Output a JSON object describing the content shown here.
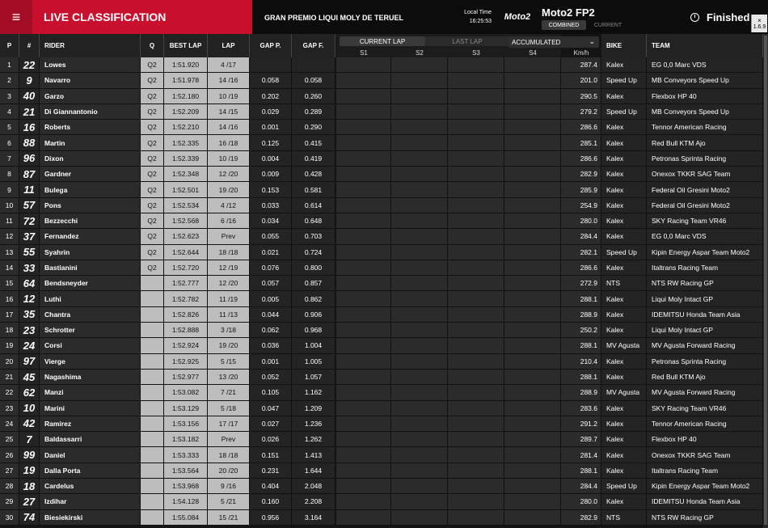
{
  "header": {
    "menu_icon": "menu-icon",
    "title": "LIVE CLASSIFICATION",
    "event": "GRAN PREMIO LIQUI MOLY DE TERUEL",
    "local_time_label": "Local Time",
    "local_time_value": "16:25:53",
    "logo_text": "Moto2",
    "session": "Moto2 FP2",
    "tab_combined": "COMBINED",
    "tab_current": "CURRENT",
    "status": "Finished",
    "version_close": "×",
    "version": "1.6.9",
    "accent_color": "#c8102e"
  },
  "columns": {
    "pos": "P",
    "num": "#",
    "rider": "RIDER",
    "q": "Q",
    "best_lap": "BEST LAP",
    "lap": "LAP",
    "gap_p": "GAP P.",
    "gap_f": "GAP F.",
    "bike": "BIKE",
    "team": "TEAM",
    "kmh": "Km/h",
    "s1": "S1",
    "s2": "S2",
    "s3": "S3",
    "s4": "S4"
  },
  "lap_mode": {
    "current": "CURRENT LAP",
    "last": "LAST LAP",
    "accumulated": "ACCUMULATED"
  },
  "riders": [
    {
      "pos": "1",
      "num": "22",
      "name": "Lowes",
      "q": "Q2",
      "best": "1:51.920",
      "lap": "4 /17",
      "gap_p": "",
      "gap_f": "",
      "kmh": "287.4",
      "bike": "Kalex",
      "team": "EG 0,0 Marc VDS"
    },
    {
      "pos": "2",
      "num": "9",
      "name": "Navarro",
      "q": "Q2",
      "best": "1:51.978",
      "lap": "14 /16",
      "gap_p": "0.058",
      "gap_f": "0.058",
      "kmh": "201.0",
      "bike": "Speed Up",
      "team": "MB Conveyors Speed Up"
    },
    {
      "pos": "3",
      "num": "40",
      "name": "Garzo",
      "q": "Q2",
      "best": "1:52.180",
      "lap": "10 /19",
      "gap_p": "0.202",
      "gap_f": "0.260",
      "kmh": "290.5",
      "bike": "Kalex",
      "team": "Flexbox HP 40"
    },
    {
      "pos": "4",
      "num": "21",
      "name": "Di Giannantonio",
      "q": "Q2",
      "best": "1:52.209",
      "lap": "14 /15",
      "gap_p": "0.029",
      "gap_f": "0.289",
      "kmh": "279.2",
      "bike": "Speed Up",
      "team": "MB Conveyors Speed Up"
    },
    {
      "pos": "5",
      "num": "16",
      "name": "Roberts",
      "q": "Q2",
      "best": "1:52.210",
      "lap": "14 /16",
      "gap_p": "0.001",
      "gap_f": "0.290",
      "kmh": "286.6",
      "bike": "Kalex",
      "team": "Tennor American Racing"
    },
    {
      "pos": "6",
      "num": "88",
      "name": "Martin",
      "q": "Q2",
      "best": "1:52.335",
      "lap": "16 /18",
      "gap_p": "0.125",
      "gap_f": "0.415",
      "kmh": "285.1",
      "bike": "Kalex",
      "team": "Red Bull KTM Ajo"
    },
    {
      "pos": "7",
      "num": "96",
      "name": "Dixon",
      "q": "Q2",
      "best": "1:52.339",
      "lap": "10 /19",
      "gap_p": "0.004",
      "gap_f": "0.419",
      "kmh": "286.6",
      "bike": "Kalex",
      "team": "Petronas Sprinta Racing"
    },
    {
      "pos": "8",
      "num": "87",
      "name": "Gardner",
      "q": "Q2",
      "best": "1:52.348",
      "lap": "12 /20",
      "gap_p": "0.009",
      "gap_f": "0.428",
      "kmh": "282.9",
      "bike": "Kalex",
      "team": "Onexox TKKR SAG Team"
    },
    {
      "pos": "9",
      "num": "11",
      "name": "Bulega",
      "q": "Q2",
      "best": "1:52.501",
      "lap": "19 /20",
      "gap_p": "0.153",
      "gap_f": "0.581",
      "kmh": "285.9",
      "bike": "Kalex",
      "team": "Federal Oil Gresini Moto2"
    },
    {
      "pos": "10",
      "num": "57",
      "name": "Pons",
      "q": "Q2",
      "best": "1:52.534",
      "lap": "4 /12",
      "gap_p": "0.033",
      "gap_f": "0.614",
      "kmh": "254.9",
      "bike": "Kalex",
      "team": "Federal Oil Gresini Moto2"
    },
    {
      "pos": "11",
      "num": "72",
      "name": "Bezzecchi",
      "q": "Q2",
      "best": "1:52.568",
      "lap": "6 /16",
      "gap_p": "0.034",
      "gap_f": "0.648",
      "kmh": "280.0",
      "bike": "Kalex",
      "team": "SKY Racing Team VR46"
    },
    {
      "pos": "12",
      "num": "37",
      "name": "Fernandez",
      "q": "Q2",
      "best": "1:52.623",
      "lap": "Prev",
      "gap_p": "0.055",
      "gap_f": "0.703",
      "kmh": "284.4",
      "bike": "Kalex",
      "team": "EG 0,0 Marc VDS"
    },
    {
      "pos": "13",
      "num": "55",
      "name": "Syahrin",
      "q": "Q2",
      "best": "1:52.644",
      "lap": "18 /18",
      "gap_p": "0.021",
      "gap_f": "0.724",
      "kmh": "282.1",
      "bike": "Speed Up",
      "team": "Kipin Energy Aspar Team Moto2"
    },
    {
      "pos": "14",
      "num": "33",
      "name": "Bastianini",
      "q": "Q2",
      "best": "1:52.720",
      "lap": "12 /19",
      "gap_p": "0.076",
      "gap_f": "0.800",
      "kmh": "286.6",
      "bike": "Kalex",
      "team": "Italtrans Racing Team"
    },
    {
      "pos": "15",
      "num": "64",
      "name": "Bendsneyder",
      "q": "",
      "best": "1:52.777",
      "lap": "12 /20",
      "gap_p": "0.057",
      "gap_f": "0.857",
      "kmh": "272.9",
      "bike": "NTS",
      "team": "NTS RW Racing GP"
    },
    {
      "pos": "16",
      "num": "12",
      "name": "Luthi",
      "q": "",
      "best": "1:52.782",
      "lap": "11 /19",
      "gap_p": "0.005",
      "gap_f": "0.862",
      "kmh": "288.1",
      "bike": "Kalex",
      "team": "Liqui Moly Intact GP"
    },
    {
      "pos": "17",
      "num": "35",
      "name": "Chantra",
      "q": "",
      "best": "1:52.826",
      "lap": "11 /13",
      "gap_p": "0.044",
      "gap_f": "0.906",
      "kmh": "288.9",
      "bike": "Kalex",
      "team": "IDEMITSU Honda Team Asia"
    },
    {
      "pos": "18",
      "num": "23",
      "name": "Schrotter",
      "q": "",
      "best": "1:52.888",
      "lap": "3 /18",
      "gap_p": "0.062",
      "gap_f": "0.968",
      "kmh": "250.2",
      "bike": "Kalex",
      "team": "Liqui Moly Intact GP"
    },
    {
      "pos": "19",
      "num": "24",
      "name": "Corsi",
      "q": "",
      "best": "1:52.924",
      "lap": "19 /20",
      "gap_p": "0.036",
      "gap_f": "1.004",
      "kmh": "288.1",
      "bike": "MV Agusta",
      "team": "MV Agusta Forward Racing"
    },
    {
      "pos": "20",
      "num": "97",
      "name": "Vierge",
      "q": "",
      "best": "1:52.925",
      "lap": "5 /15",
      "gap_p": "0.001",
      "gap_f": "1.005",
      "kmh": "210.4",
      "bike": "Kalex",
      "team": "Petronas Sprinta Racing"
    },
    {
      "pos": "21",
      "num": "45",
      "name": "Nagashima",
      "q": "",
      "best": "1:52.977",
      "lap": "13 /20",
      "gap_p": "0.052",
      "gap_f": "1.057",
      "kmh": "288.1",
      "bike": "Kalex",
      "team": "Red Bull KTM Ajo"
    },
    {
      "pos": "22",
      "num": "62",
      "name": "Manzi",
      "q": "",
      "best": "1:53.082",
      "lap": "7 /21",
      "gap_p": "0.105",
      "gap_f": "1.162",
      "kmh": "288.9",
      "bike": "MV Agusta",
      "team": "MV Agusta Forward Racing"
    },
    {
      "pos": "23",
      "num": "10",
      "name": "Marini",
      "q": "",
      "best": "1:53.129",
      "lap": "5 /18",
      "gap_p": "0.047",
      "gap_f": "1.209",
      "kmh": "283.6",
      "bike": "Kalex",
      "team": "SKY Racing Team VR46"
    },
    {
      "pos": "24",
      "num": "42",
      "name": "Ramirez",
      "q": "",
      "best": "1:53.156",
      "lap": "17 /17",
      "gap_p": "0.027",
      "gap_f": "1.236",
      "kmh": "291.2",
      "bike": "Kalex",
      "team": "Tennor American Racing"
    },
    {
      "pos": "25",
      "num": "7",
      "name": "Baldassarri",
      "q": "",
      "best": "1:53.182",
      "lap": "Prev",
      "gap_p": "0.026",
      "gap_f": "1.262",
      "kmh": "289.7",
      "bike": "Kalex",
      "team": "Flexbox HP 40"
    },
    {
      "pos": "26",
      "num": "99",
      "name": "Daniel",
      "q": "",
      "best": "1:53.333",
      "lap": "18 /18",
      "gap_p": "0.151",
      "gap_f": "1.413",
      "kmh": "281.4",
      "bike": "Kalex",
      "team": "Onexox TKKR SAG Team"
    },
    {
      "pos": "27",
      "num": "19",
      "name": "Dalla Porta",
      "q": "",
      "best": "1:53.564",
      "lap": "20 /20",
      "gap_p": "0.231",
      "gap_f": "1.644",
      "kmh": "288.1",
      "bike": "Kalex",
      "team": "Italtrans Racing Team"
    },
    {
      "pos": "28",
      "num": "18",
      "name": "Cardelus",
      "q": "",
      "best": "1:53.968",
      "lap": "9 /16",
      "gap_p": "0.404",
      "gap_f": "2.048",
      "kmh": "284.4",
      "bike": "Speed Up",
      "team": "Kipin Energy Aspar Team Moto2"
    },
    {
      "pos": "29",
      "num": "27",
      "name": "Izdihar",
      "q": "",
      "best": "1:54.128",
      "lap": "5 /21",
      "gap_p": "0.160",
      "gap_f": "2.208",
      "kmh": "280.0",
      "bike": "Kalex",
      "team": "IDEMITSU Honda Team Asia"
    },
    {
      "pos": "30",
      "num": "74",
      "name": "Biesiekirski",
      "q": "",
      "best": "1:55.084",
      "lap": "15 /21",
      "gap_p": "0.956",
      "gap_f": "3.164",
      "kmh": "282.9",
      "bike": "NTS",
      "team": "NTS RW Racing GP"
    }
  ]
}
